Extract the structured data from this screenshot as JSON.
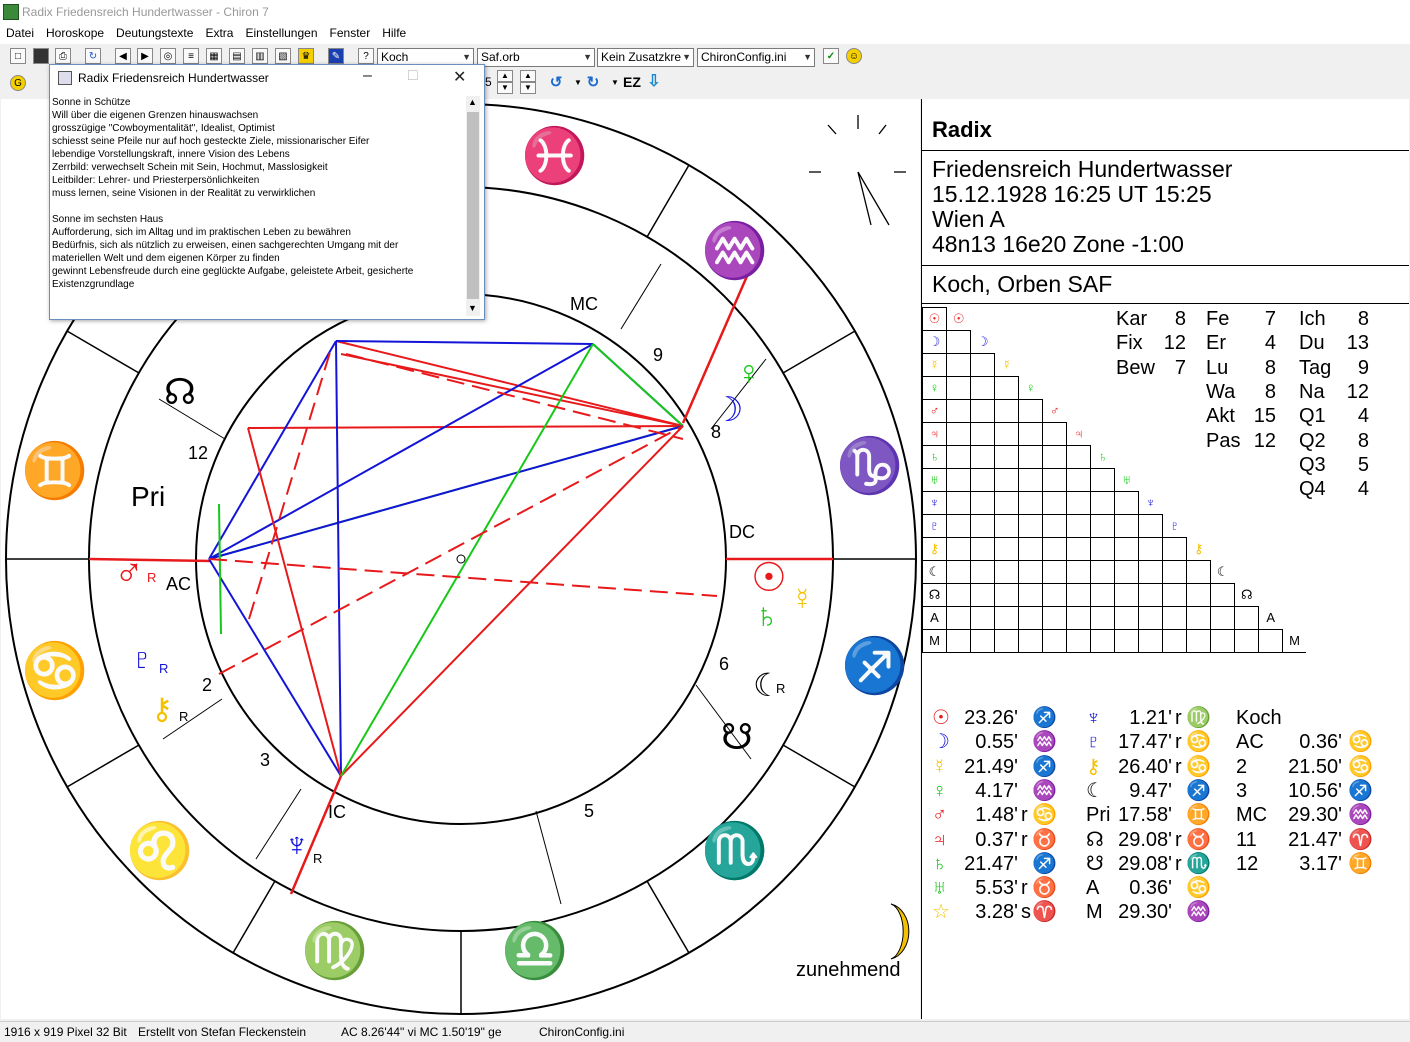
{
  "window": {
    "title": "Radix Friedensreich Hundertwasser - Chiron 7"
  },
  "menu": [
    "Datei",
    "Horoskope",
    "Deutungstexte",
    "Extra",
    "Einstellungen",
    "Fenster",
    "Hilfe"
  ],
  "toolbar": {
    "house_system": "Koch",
    "orb_file": "Saf.orb",
    "extra_option": "Kein Zusatzkre",
    "config_file": "ChironConfig.ini",
    "stepper_value": "5",
    "ez_label": "EZ"
  },
  "popup": {
    "title": "Radix Friedensreich Hundertwasser",
    "text": "Sonne in Schütze\nWill über die eigenen Grenzen hinauswachsen\ngrosszügige \"Cowboymentalität\", Idealist, Optimist\nschiesst seine Pfeile nur auf hoch gesteckte Ziele, missionarischer Eifer\nlebendige Vorstellungskraft, innere Vision des Lebens\nZerrbild: verwechselt Schein mit Sein, Hochmut, Masslosigkeit\nLeitbilder: Lehrer- und Priesterpersönlichkeiten\nmuss lernen, seine Visionen in der Realität zu verwirklichen\n\nSonne im sechsten Haus\nAufforderung, sich im Alltag und im praktischen Leben zu bewähren\nBedürfnis, sich als nützlich zu erweisen, einen sachgerechten Umgang mit der\nmateriellen Welt und dem eigenen Körper zu finden\ngewinnt Lebensfreude durch eine geglückte Aufgabe, geleistete Arbeit, gesicherte\nExistenzgrundlage"
  },
  "chart": {
    "house_labels": {
      "mc": "MC",
      "ic": "IC",
      "ac": "AC",
      "dc": "DC"
    },
    "house_numbers": [
      "2",
      "3",
      "5",
      "6",
      "8",
      "9",
      "12"
    ],
    "pri_label": "Pri",
    "retro_mark": "R",
    "moon_phase": "zunehmend",
    "colors": {
      "fire": "#e8191b",
      "water": "#1414d8",
      "air": "#f5c000",
      "earth": "#18c818"
    }
  },
  "panel": {
    "heading": "Radix",
    "name": "Friedensreich Hundertwasser",
    "datetime": "15.12.1928 16:25 UT 15:25",
    "place": "Wien A",
    "coords": "48n13 16e20 Zone -1:00",
    "system": "Koch, Orben SAF",
    "stats": [
      {
        "label": "Kar",
        "value": "8"
      },
      {
        "label": "Fe",
        "value": "7"
      },
      {
        "label": "Ich",
        "value": "8"
      },
      {
        "label": "Fix",
        "value": "12"
      },
      {
        "label": "Er",
        "value": "4"
      },
      {
        "label": "Du",
        "value": "13"
      },
      {
        "label": "Bew",
        "value": "7"
      },
      {
        "label": "Lu",
        "value": "8"
      },
      {
        "label": "Tag",
        "value": "9"
      },
      {
        "label": "Wa",
        "value": "8"
      },
      {
        "label": "Na",
        "value": "12"
      },
      {
        "label": "Akt",
        "value": "15"
      },
      {
        "label": "Q1",
        "value": "4"
      },
      {
        "label": "Pas",
        "value": "12"
      },
      {
        "label": "Q2",
        "value": "8"
      },
      {
        "label": "Q3",
        "value": "5"
      },
      {
        "label": "Q4",
        "value": "4"
      }
    ],
    "grid_rows": [
      "☉",
      "☽",
      "☿",
      "♀",
      "♂",
      "♃",
      "♄",
      "♅",
      "♆",
      "♇",
      "⚷",
      "☾",
      "☊",
      "A",
      "M"
    ],
    "positions_col1": [
      {
        "glyph": "☉",
        "value": "23.26'",
        "flag": "",
        "sign": "♐"
      },
      {
        "glyph": "☽",
        "value": "0.55'",
        "flag": "",
        "sign": "♒"
      },
      {
        "glyph": "☿",
        "value": "21.49'",
        "flag": "",
        "sign": "♐"
      },
      {
        "glyph": "♀",
        "value": "4.17'",
        "flag": "",
        "sign": "♒"
      },
      {
        "glyph": "♂",
        "value": "1.48'",
        "flag": "r",
        "sign": "♋"
      },
      {
        "glyph": "♃",
        "value": "0.37'",
        "flag": "r",
        "sign": "♉"
      },
      {
        "glyph": "♄",
        "value": "21.47'",
        "flag": "",
        "sign": "♐"
      },
      {
        "glyph": "♅",
        "value": "5.53'",
        "flag": "r",
        "sign": "♉"
      },
      {
        "glyph": "☆",
        "value": "3.28'",
        "flag": "s",
        "sign": "♈"
      }
    ],
    "positions_col2": [
      {
        "glyph": "♆",
        "value": "1.21'",
        "flag": "r",
        "sign": "♍"
      },
      {
        "glyph": "♇",
        "value": "17.47'",
        "flag": "r",
        "sign": "♋"
      },
      {
        "glyph": "⚷",
        "value": "26.40'",
        "flag": "r",
        "sign": "♋"
      },
      {
        "glyph": "☾",
        "value": "9.47'",
        "flag": "",
        "sign": "♐"
      },
      {
        "glyph": "Pri",
        "value": "17.58'",
        "flag": "",
        "sign": "♊"
      },
      {
        "glyph": "☊",
        "value": "29.08'",
        "flag": "r",
        "sign": "♉"
      },
      {
        "glyph": "☋",
        "value": "29.08'",
        "flag": "r",
        "sign": "♏"
      },
      {
        "glyph": "A",
        "value": "0.36'",
        "flag": "",
        "sign": "♋"
      },
      {
        "glyph": "M",
        "value": "29.30'",
        "flag": "",
        "sign": "♒"
      }
    ],
    "houses": [
      {
        "label": "Koch",
        "value": "",
        "sign": ""
      },
      {
        "label": "AC",
        "value": "0.36'",
        "sign": "♋"
      },
      {
        "label": "2",
        "value": "21.50'",
        "sign": "♋"
      },
      {
        "label": "3",
        "value": "10.56'",
        "sign": "♐"
      },
      {
        "label": "MC",
        "value": "29.30'",
        "sign": "♒"
      },
      {
        "label": "11",
        "value": "21.47'",
        "sign": "♈"
      },
      {
        "label": "12",
        "value": "3.17'",
        "sign": "♊"
      }
    ]
  },
  "status": {
    "resolution": "1916 x 919 Pixel 32 Bit",
    "author": "Erstellt von Stefan Fleckenstein",
    "angles": "AC  8.26'44\" vi  MC  1.50'19\" ge",
    "config": "ChironConfig.ini"
  }
}
